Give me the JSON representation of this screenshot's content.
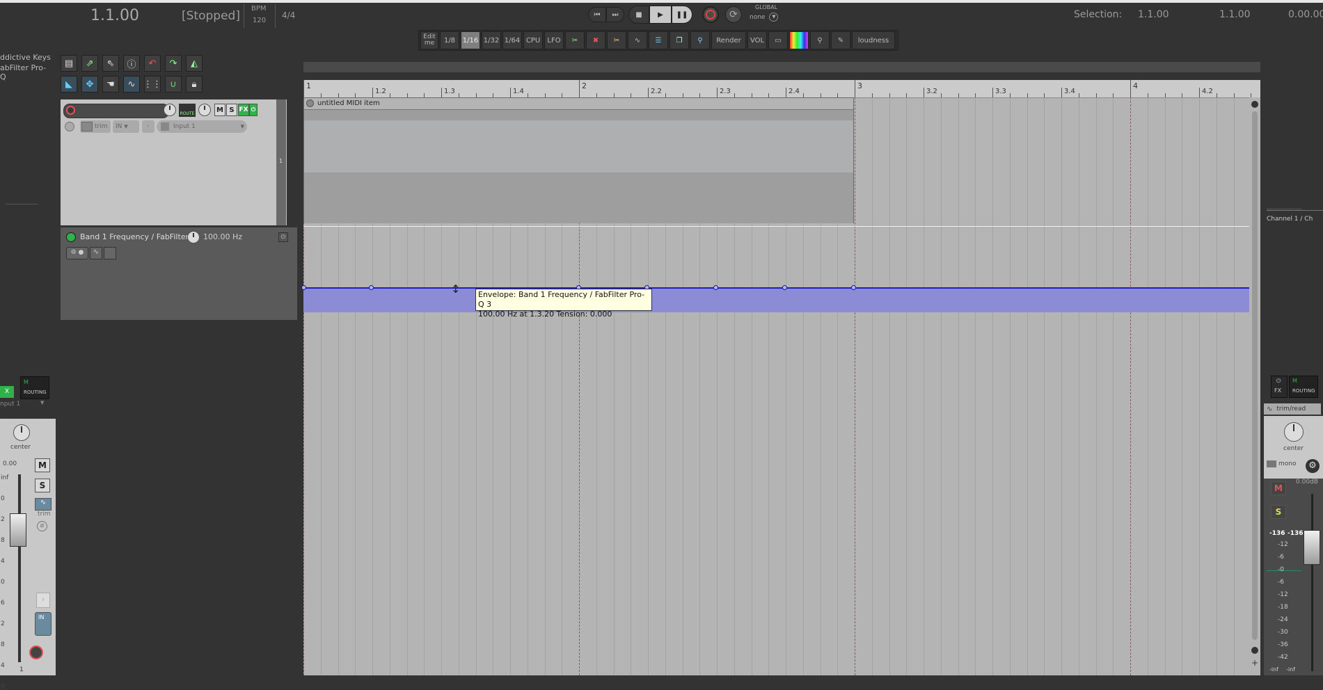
{
  "transport": {
    "position": "1.1.00",
    "state": "[Stopped]",
    "bpm_label": "BPM",
    "bpm_value": "120",
    "time_sig": "4/4",
    "global_label": "GLOBAL",
    "global_value": "none"
  },
  "selection": {
    "label": "Selection:",
    "start": "1.1.00",
    "end": "1.1.00",
    "length": "0.00.00"
  },
  "toolbar": {
    "edit_label": "Edit me",
    "grid": [
      "1/8",
      "1/16",
      "1/32",
      "1/64"
    ],
    "active_grid": "1/16",
    "cpu": "CPU",
    "lfo": "LFO",
    "render": "Render",
    "vol": "VOL",
    "loudness": "loudness"
  },
  "fx_list": [
    "ddictive Keys",
    "abFilter Pro-Q"
  ],
  "ruler": {
    "labels": [
      "1",
      "1.2",
      "1.3",
      "1.4",
      "2",
      "2.2",
      "2.3",
      "2.4",
      "3",
      "3.2",
      "3.3",
      "3.4",
      "4",
      "4.2"
    ]
  },
  "track1": {
    "route_label": "ROUTE",
    "m": "M",
    "s": "S",
    "fx": "FX",
    "trim": "trim",
    "in_label": "IN",
    "input": "Input 1",
    "number": "1"
  },
  "envelope_lane": {
    "name": "Band 1 Frequency / FabFilter P",
    "value": "100.00 Hz",
    "color": "#2020c0"
  },
  "midi_item": {
    "name": "untitled MIDI item"
  },
  "tooltip": {
    "line1": "Envelope: Band 1 Frequency / FabFilter Pro-Q 3",
    "line2": "100.00 Hz at 1.3.20 Tension: 0.000"
  },
  "left_mixer": {
    "fx": "X",
    "routing": "ROUTING",
    "input": "nput 1",
    "pan": "center",
    "vol": "0.00",
    "m": "M",
    "s": "S",
    "trim": "trim",
    "in": "IN",
    "number": "1",
    "scale": [
      "inf",
      "0",
      "2",
      "8",
      "4",
      "0",
      "6",
      "2",
      "8",
      "4",
      "0"
    ]
  },
  "master_mixer": {
    "name": "Channel 1 / Ch",
    "fx": "FX",
    "routing": "ROUTING",
    "env_mode": "trim/read",
    "pan": "center",
    "mono": "mono",
    "vol": "0.00dB",
    "m": "M",
    "s": "S",
    "peak_l": "-136",
    "peak_r": "-136",
    "scale": [
      "-12",
      "-6",
      "-0",
      "-6",
      "-12",
      "-18",
      "-24",
      "-30",
      "-36",
      "-42"
    ],
    "inf_l": "-inf",
    "inf_r": "-inf"
  }
}
